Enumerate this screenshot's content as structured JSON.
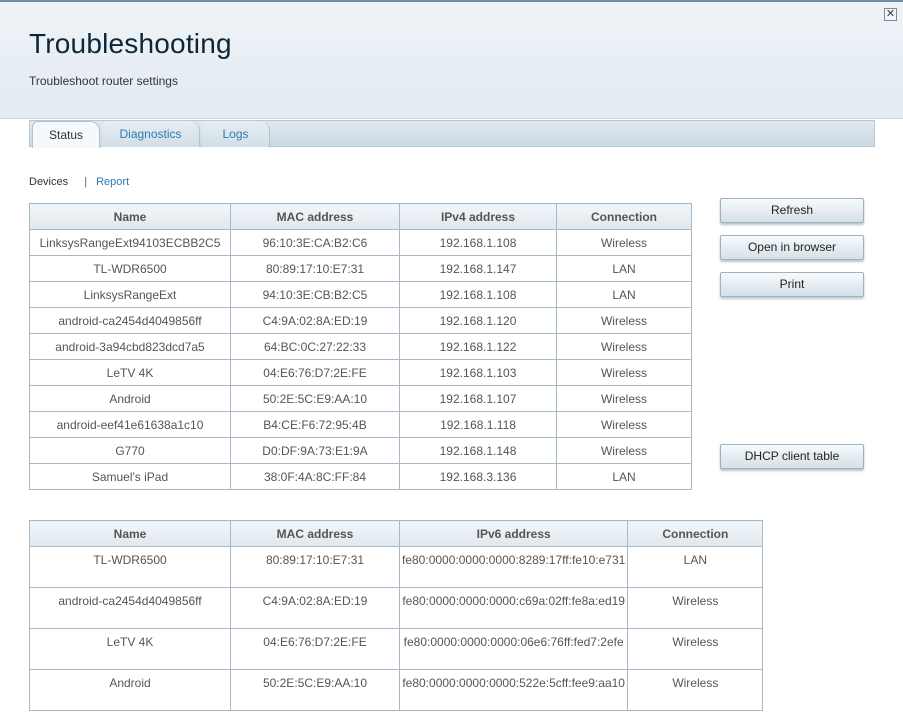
{
  "header": {
    "title": "Troubleshooting",
    "subtitle": "Troubleshoot router settings",
    "close": "✕"
  },
  "tabs": [
    {
      "label": "Status",
      "active": true
    },
    {
      "label": "Diagnostics",
      "active": false
    },
    {
      "label": "Logs",
      "active": false
    }
  ],
  "subnav": {
    "devices": "Devices",
    "separator": "|",
    "report": "Report"
  },
  "ipv4_table": {
    "headers": [
      "Name",
      "MAC address",
      "IPv4 address",
      "Connection"
    ],
    "rows": [
      [
        "LinksysRangeExt94103ECBB2C5",
        "96:10:3E:CA:B2:C6",
        "192.168.1.108",
        "Wireless"
      ],
      [
        "TL-WDR6500",
        "80:89:17:10:E7:31",
        "192.168.1.147",
        "LAN"
      ],
      [
        "LinksysRangeExt",
        "94:10:3E:CB:B2:C5",
        "192.168.1.108",
        "LAN"
      ],
      [
        "android-ca2454d4049856ff",
        "C4:9A:02:8A:ED:19",
        "192.168.1.120",
        "Wireless"
      ],
      [
        "android-3a94cbd823dcd7a5",
        "64:BC:0C:27:22:33",
        "192.168.1.122",
        "Wireless"
      ],
      [
        "LeTV 4K",
        "04:E6:76:D7:2E:FE",
        "192.168.1.103",
        "Wireless"
      ],
      [
        "Android",
        "50:2E:5C:E9:AA:10",
        "192.168.1.107",
        "Wireless"
      ],
      [
        "android-eef41e61638a1c10",
        "B4:CE:F6:72:95:4B",
        "192.168.1.118",
        "Wireless"
      ],
      [
        "G770",
        "D0:DF:9A:73:E1:9A",
        "192.168.1.148",
        "Wireless"
      ],
      [
        "Samuel's iPad",
        "38:0F:4A:8C:FF:84",
        "192.168.3.136",
        "LAN"
      ]
    ]
  },
  "ipv6_table": {
    "headers": [
      "Name",
      "MAC address",
      "IPv6 address",
      "Connection"
    ],
    "rows": [
      [
        "TL-WDR6500",
        "80:89:17:10:E7:31",
        "fe80:0000:0000:0000:8289:17ff:fe10:e731",
        "LAN"
      ],
      [
        "android-ca2454d4049856ff",
        "C4:9A:02:8A:ED:19",
        "fe80:0000:0000:0000:c69a:02ff:fe8a:ed19",
        "Wireless"
      ],
      [
        "LeTV 4K",
        "04:E6:76:D7:2E:FE",
        "fe80:0000:0000:0000:06e6:76ff:fed7:2efe",
        "Wireless"
      ],
      [
        "Android",
        "50:2E:5C:E9:AA:10",
        "fe80:0000:0000:0000:522e:5cff:fee9:aa10",
        "Wireless"
      ]
    ]
  },
  "buttons": {
    "refresh": "Refresh",
    "open_in_browser": "Open in browser",
    "print": "Print",
    "dhcp_client_table": "DHCP client table"
  },
  "colors": {
    "link": "#2e7bb4",
    "title": "#0f2636",
    "border": "#a8b8c4"
  }
}
